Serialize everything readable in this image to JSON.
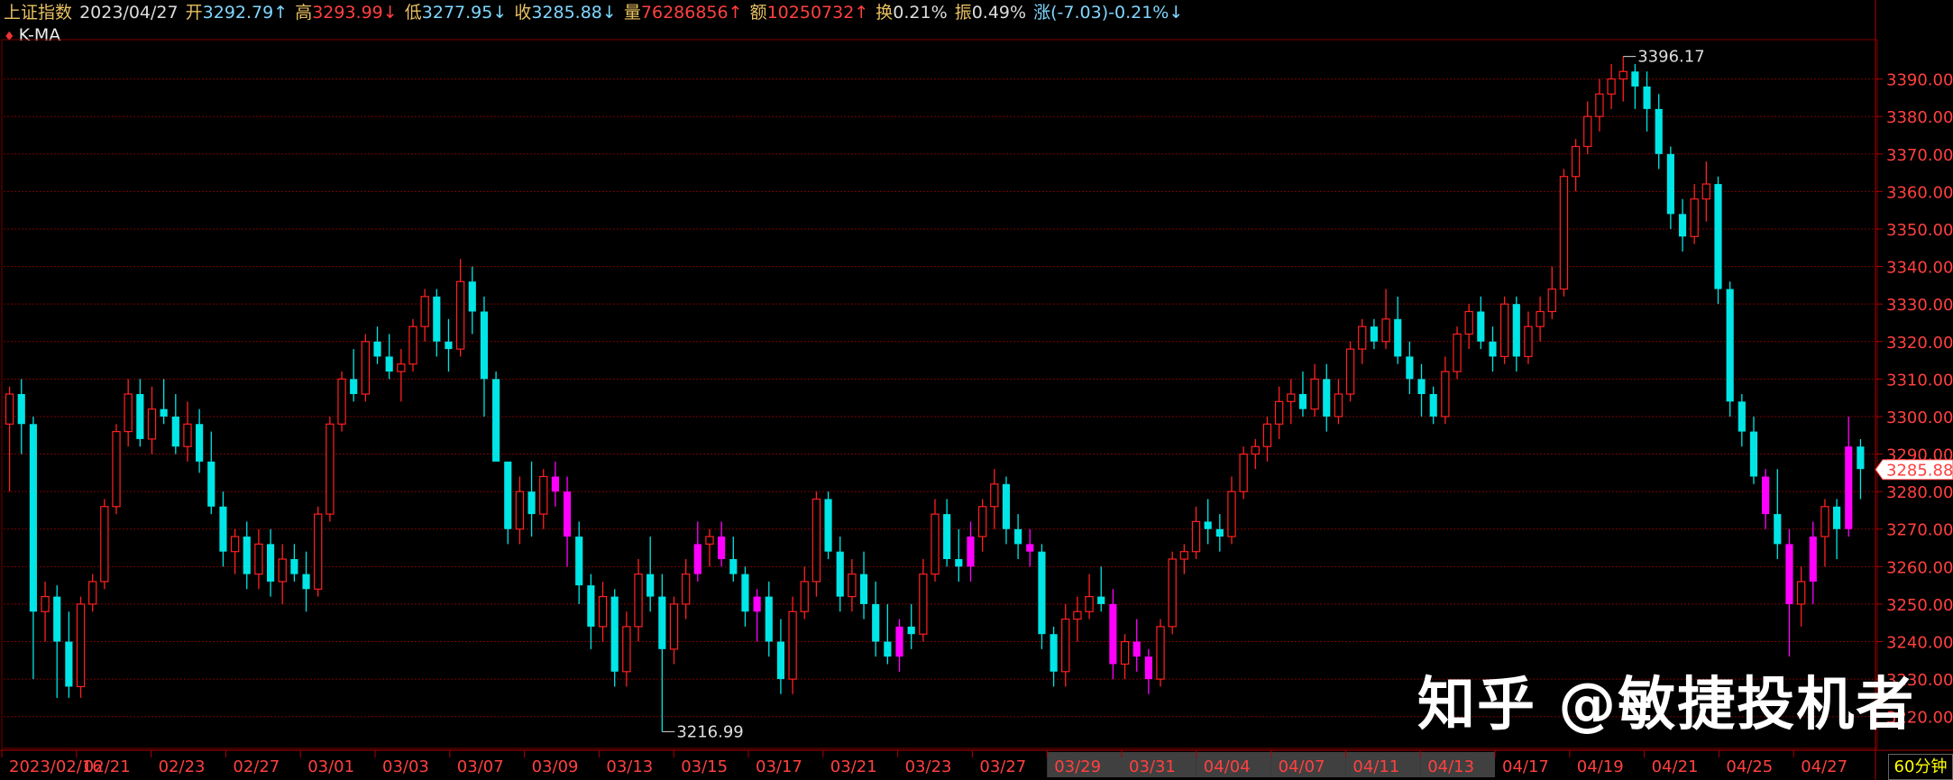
{
  "infobar": {
    "index_name": "上证指数",
    "date": "2023/04/27",
    "open_label": "开",
    "open": "3292.79",
    "high_label": "高",
    "high": "3293.99",
    "low_label": "低",
    "low": "3277.95",
    "close_label": "收",
    "close": "3285.88",
    "volume_label": "量",
    "volume": "76286856",
    "amount_label": "额",
    "amount": "10250732",
    "turnover_label": "换",
    "turnover": "0.21%",
    "amplitude_label": "振",
    "amplitude": "0.49%",
    "change_label": "涨",
    "change": "(-7.03)-0.21%",
    "arrow_up": "↑",
    "arrow_down": "↓"
  },
  "indicator_label": "K-MA",
  "watermark": "知乎 @敏捷投机者",
  "period_button": "60分钟",
  "colors": {
    "up_candle": "#ff2020",
    "down_candle": "#00e5e5",
    "highlight_candle": "#ff00ff",
    "grid": "#7a0000",
    "axis_text": "#ff4040",
    "price_tag": "#ff4040",
    "date_text": "#ff4040"
  },
  "chart_data": {
    "type": "candlestick",
    "symbol": "上证指数",
    "period": "60分钟",
    "ylim": [
      3212,
      3400
    ],
    "y_ticks": [
      3220,
      3230,
      3240,
      3250,
      3260,
      3270,
      3280,
      3290,
      3300,
      3310,
      3320,
      3330,
      3340,
      3350,
      3360,
      3370,
      3380,
      3390
    ],
    "y_tick_labels": [
      "3220.00",
      "3230.00",
      "3240.00",
      "3250.00",
      "3260.00",
      "3270.00",
      "3280.00",
      "3290.00",
      "3300.00",
      "3310.00",
      "3320.00",
      "3330.00",
      "3340.00",
      "3350.00",
      "3360.00",
      "3370.00",
      "3380.00",
      "3390.00"
    ],
    "date_labels": [
      "2023/02/16",
      "02/21",
      "02/23",
      "02/27",
      "03/01",
      "03/03",
      "03/07",
      "03/09",
      "03/13",
      "03/15",
      "03/17",
      "03/21",
      "03/23",
      "03/27",
      "03/29",
      "03/31",
      "04/04",
      "04/07",
      "04/11",
      "04/13",
      "04/17",
      "04/19",
      "04/21",
      "04/25",
      "04/27"
    ],
    "max_label": "3396.17",
    "min_label": "3216.99",
    "last_price_label": "3285.88",
    "candles": [
      [
        3298,
        3308,
        3280,
        3306
      ],
      [
        3306,
        3310,
        3290,
        3298
      ],
      [
        3298,
        3300,
        3230,
        3248
      ],
      [
        3248,
        3256,
        3240,
        3252
      ],
      [
        3252,
        3255,
        3225,
        3240
      ],
      [
        3240,
        3248,
        3225,
        3228
      ],
      [
        3228,
        3252,
        3225,
        3250
      ],
      [
        3250,
        3258,
        3248,
        3256
      ],
      [
        3256,
        3278,
        3254,
        3276
      ],
      [
        3276,
        3298,
        3274,
        3296
      ],
      [
        3296,
        3310,
        3292,
        3306
      ],
      [
        3306,
        3310,
        3292,
        3294
      ],
      [
        3294,
        3308,
        3290,
        3302
      ],
      [
        3302,
        3310,
        3298,
        3300
      ],
      [
        3300,
        3306,
        3290,
        3292
      ],
      [
        3292,
        3304,
        3288,
        3298
      ],
      [
        3298,
        3302,
        3285,
        3288
      ],
      [
        3288,
        3296,
        3274,
        3276
      ],
      [
        3276,
        3280,
        3260,
        3264
      ],
      [
        3264,
        3270,
        3258,
        3268
      ],
      [
        3268,
        3272,
        3254,
        3258
      ],
      [
        3258,
        3270,
        3254,
        3266
      ],
      [
        3266,
        3270,
        3252,
        3256
      ],
      [
        3256,
        3266,
        3250,
        3262
      ],
      [
        3262,
        3266,
        3256,
        3258
      ],
      [
        3258,
        3264,
        3248,
        3254
      ],
      [
        3254,
        3276,
        3252,
        3274
      ],
      [
        3274,
        3300,
        3272,
        3298
      ],
      [
        3298,
        3312,
        3296,
        3310
      ],
      [
        3310,
        3318,
        3304,
        3306
      ],
      [
        3306,
        3322,
        3304,
        3320
      ],
      [
        3320,
        3324,
        3314,
        3316
      ],
      [
        3316,
        3322,
        3310,
        3312
      ],
      [
        3312,
        3318,
        3304,
        3314
      ],
      [
        3314,
        3326,
        3312,
        3324
      ],
      [
        3324,
        3334,
        3320,
        3332
      ],
      [
        3332,
        3334,
        3316,
        3320
      ],
      [
        3320,
        3326,
        3312,
        3318
      ],
      [
        3318,
        3342,
        3316,
        3336
      ],
      [
        3336,
        3340,
        3322,
        3328
      ],
      [
        3328,
        3332,
        3300,
        3310
      ],
      [
        3310,
        3312,
        3290,
        3288
      ],
      [
        3288,
        3282,
        3266,
        3270
      ],
      [
        3270,
        3284,
        3266,
        3280
      ],
      [
        3280,
        3288,
        3268,
        3274
      ],
      [
        3274,
        3286,
        3270,
        3284
      ],
      [
        3284,
        3288,
        3276,
        3280
      ],
      [
        3280,
        3284,
        3260,
        3268
      ],
      [
        3268,
        3272,
        3250,
        3255
      ],
      [
        3255,
        3258,
        3238,
        3244
      ],
      [
        3244,
        3256,
        3240,
        3252
      ],
      [
        3252,
        3254,
        3228,
        3232
      ],
      [
        3232,
        3248,
        3228,
        3244
      ],
      [
        3244,
        3262,
        3240,
        3258
      ],
      [
        3258,
        3268,
        3248,
        3252
      ],
      [
        3252,
        3258,
        3216,
        3238
      ],
      [
        3238,
        3252,
        3234,
        3250
      ],
      [
        3250,
        3262,
        3246,
        3258
      ],
      [
        3258,
        3272,
        3256,
        3266
      ],
      [
        3266,
        3270,
        3260,
        3268
      ],
      [
        3268,
        3272,
        3260,
        3262
      ],
      [
        3262,
        3268,
        3256,
        3258
      ],
      [
        3258,
        3260,
        3244,
        3248
      ],
      [
        3248,
        3254,
        3240,
        3252
      ],
      [
        3252,
        3256,
        3236,
        3240
      ],
      [
        3240,
        3246,
        3226,
        3230
      ],
      [
        3230,
        3252,
        3226,
        3248
      ],
      [
        3248,
        3260,
        3246,
        3256
      ],
      [
        3256,
        3280,
        3252,
        3278
      ],
      [
        3278,
        3280,
        3262,
        3264
      ],
      [
        3264,
        3268,
        3248,
        3252
      ],
      [
        3252,
        3262,
        3248,
        3258
      ],
      [
        3258,
        3264,
        3246,
        3250
      ],
      [
        3250,
        3256,
        3236,
        3240
      ],
      [
        3240,
        3250,
        3234,
        3236
      ],
      [
        3236,
        3246,
        3232,
        3244
      ],
      [
        3244,
        3250,
        3238,
        3242
      ],
      [
        3242,
        3262,
        3240,
        3258
      ],
      [
        3258,
        3278,
        3256,
        3274
      ],
      [
        3274,
        3278,
        3260,
        3262
      ],
      [
        3262,
        3270,
        3256,
        3260
      ],
      [
        3260,
        3272,
        3256,
        3268
      ],
      [
        3268,
        3278,
        3264,
        3276
      ],
      [
        3276,
        3286,
        3270,
        3282
      ],
      [
        3282,
        3284,
        3266,
        3270
      ],
      [
        3270,
        3274,
        3262,
        3266
      ],
      [
        3266,
        3270,
        3260,
        3264
      ],
      [
        3264,
        3266,
        3238,
        3242
      ],
      [
        3242,
        3244,
        3228,
        3232
      ],
      [
        3232,
        3250,
        3228,
        3246
      ],
      [
        3246,
        3252,
        3240,
        3248
      ],
      [
        3248,
        3258,
        3246,
        3252
      ],
      [
        3252,
        3260,
        3248,
        3250
      ],
      [
        3250,
        3254,
        3230,
        3234
      ],
      [
        3234,
        3242,
        3230,
        3240
      ],
      [
        3240,
        3246,
        3232,
        3236
      ],
      [
        3236,
        3238,
        3226,
        3230
      ],
      [
        3230,
        3246,
        3228,
        3244
      ],
      [
        3244,
        3264,
        3242,
        3262
      ],
      [
        3262,
        3266,
        3258,
        3264
      ],
      [
        3264,
        3276,
        3262,
        3272
      ],
      [
        3272,
        3278,
        3266,
        3270
      ],
      [
        3270,
        3274,
        3264,
        3268
      ],
      [
        3268,
        3284,
        3266,
        3280
      ],
      [
        3280,
        3292,
        3278,
        3290
      ],
      [
        3290,
        3294,
        3286,
        3292
      ],
      [
        3292,
        3300,
        3288,
        3298
      ],
      [
        3298,
        3308,
        3294,
        3304
      ],
      [
        3304,
        3310,
        3298,
        3306
      ],
      [
        3306,
        3312,
        3300,
        3302
      ],
      [
        3302,
        3314,
        3300,
        3310
      ],
      [
        3310,
        3314,
        3296,
        3300
      ],
      [
        3300,
        3310,
        3298,
        3306
      ],
      [
        3306,
        3320,
        3304,
        3318
      ],
      [
        3318,
        3326,
        3314,
        3324
      ],
      [
        3324,
        3326,
        3318,
        3320
      ],
      [
        3320,
        3334,
        3318,
        3326
      ],
      [
        3326,
        3332,
        3314,
        3316
      ],
      [
        3316,
        3320,
        3306,
        3310
      ],
      [
        3310,
        3314,
        3300,
        3306
      ],
      [
        3306,
        3308,
        3298,
        3300
      ],
      [
        3300,
        3316,
        3298,
        3312
      ],
      [
        3312,
        3324,
        3310,
        3322
      ],
      [
        3322,
        3330,
        3318,
        3328
      ],
      [
        3328,
        3332,
        3318,
        3320
      ],
      [
        3320,
        3324,
        3312,
        3316
      ],
      [
        3316,
        3332,
        3314,
        3330
      ],
      [
        3330,
        3332,
        3312,
        3316
      ],
      [
        3316,
        3328,
        3314,
        3324
      ],
      [
        3324,
        3332,
        3320,
        3328
      ],
      [
        3328,
        3340,
        3326,
        3334
      ],
      [
        3334,
        3366,
        3332,
        3364
      ],
      [
        3364,
        3374,
        3360,
        3372
      ],
      [
        3372,
        3384,
        3370,
        3380
      ],
      [
        3380,
        3390,
        3376,
        3386
      ],
      [
        3386,
        3394,
        3382,
        3390
      ],
      [
        3390,
        3396,
        3384,
        3392
      ],
      [
        3392,
        3394,
        3382,
        3388
      ],
      [
        3388,
        3392,
        3376,
        3382
      ],
      [
        3382,
        3386,
        3366,
        3370
      ],
      [
        3370,
        3372,
        3350,
        3354
      ],
      [
        3354,
        3358,
        3344,
        3348
      ],
      [
        3348,
        3362,
        3346,
        3358
      ],
      [
        3358,
        3368,
        3352,
        3362
      ],
      [
        3362,
        3364,
        3330,
        3334
      ],
      [
        3334,
        3336,
        3300,
        3304
      ],
      [
        3304,
        3306,
        3292,
        3296
      ],
      [
        3296,
        3300,
        3282,
        3284
      ],
      [
        3284,
        3286,
        3270,
        3274
      ],
      [
        3274,
        3286,
        3262,
        3266
      ],
      [
        3266,
        3270,
        3236,
        3250
      ],
      [
        3250,
        3260,
        3244,
        3256
      ],
      [
        3256,
        3272,
        3250,
        3268
      ],
      [
        3268,
        3278,
        3260,
        3276
      ],
      [
        3276,
        3278,
        3262,
        3270
      ],
      [
        3270,
        3300,
        3268,
        3292
      ],
      [
        3292,
        3294,
        3278,
        3286
      ]
    ],
    "highlight_indices": [
      46,
      47,
      58,
      60,
      63,
      75,
      81,
      86,
      93,
      95,
      96,
      148,
      150,
      152,
      155
    ]
  }
}
